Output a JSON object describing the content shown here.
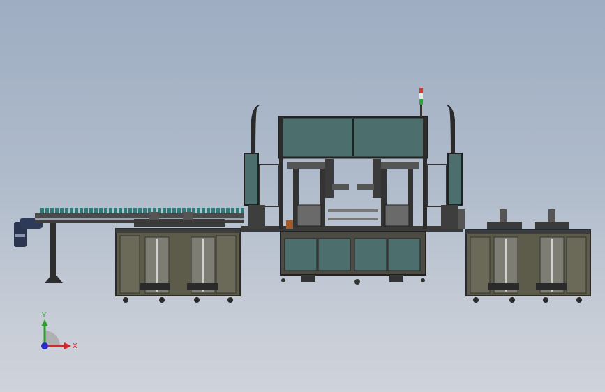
{
  "viewport": {
    "background_top": "#9eadc2",
    "background_bottom": "#cfd3da"
  },
  "triad": {
    "x_label": "X",
    "y_label": "Y",
    "x_color": "#d42a2a",
    "y_color": "#2aa02a",
    "z_color": "#2b2bd0"
  },
  "machine": {
    "frame_color": "#3a3a3a",
    "panel_color": "#4c6e6c",
    "cabinet_color": "#5d5c4b",
    "conveyor_color": "#2f7a76",
    "beacon_colors": [
      "#d23a2a",
      "#e8e8e8",
      "#2aa33a"
    ]
  }
}
